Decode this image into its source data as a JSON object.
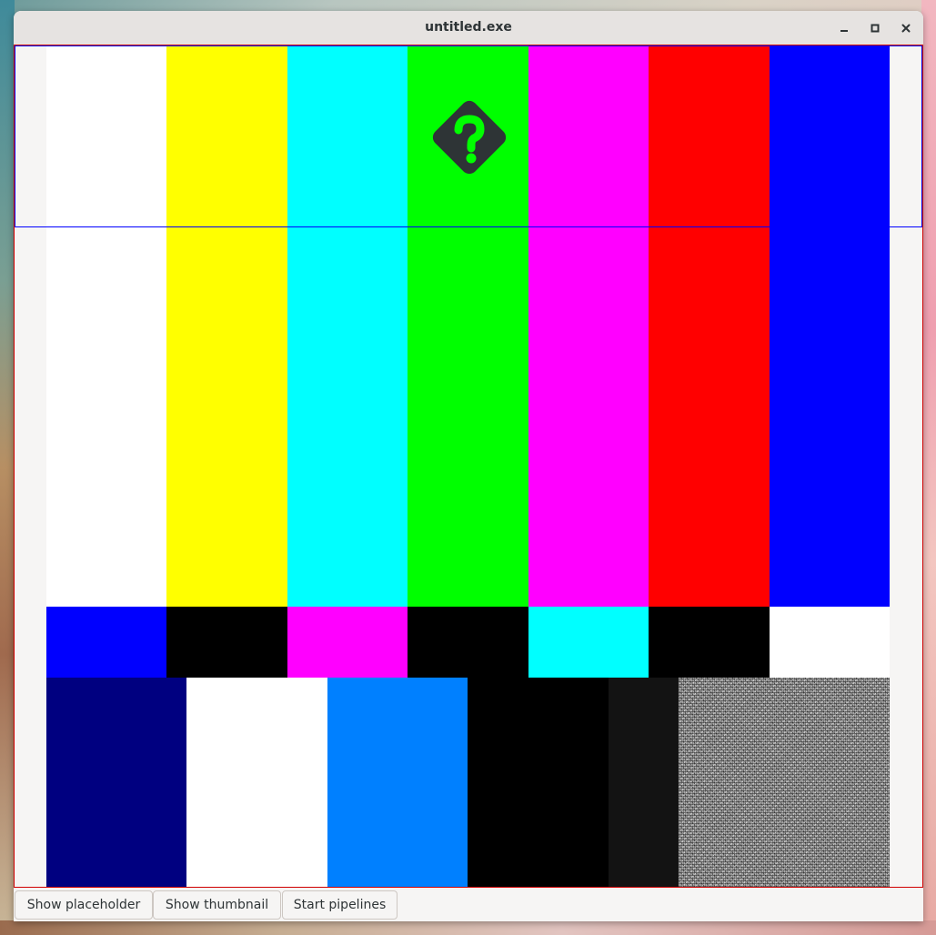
{
  "window": {
    "title": "untitled.exe",
    "controls": {
      "minimize_icon": "minimize-icon",
      "maximize_icon": "maximize-icon",
      "close_icon": "close-icon"
    }
  },
  "video": {
    "pattern": "SMPTE color bars",
    "placeholder_icon": "help-diamond-icon",
    "overlay_border_color": "#0000ff",
    "frame_border_color": "#d00000",
    "top_bar_colors": [
      "#ffffff",
      "#ffff00",
      "#00ffff",
      "#00ff00",
      "#ff00ff",
      "#ff0000",
      "#0000ff"
    ],
    "middle_bar_colors": [
      "#0000ff",
      "#000000",
      "#ff00ff",
      "#000000",
      "#00ffff",
      "#000000",
      "#ffffff"
    ],
    "bottom_bar_colors": [
      "#000080",
      "#ffffff",
      "#0080ff",
      "#000000",
      "#131313",
      "noise"
    ]
  },
  "buttons": [
    {
      "label": "Show placeholder"
    },
    {
      "label": "Show thumbnail"
    },
    {
      "label": "Start pipelines"
    }
  ]
}
